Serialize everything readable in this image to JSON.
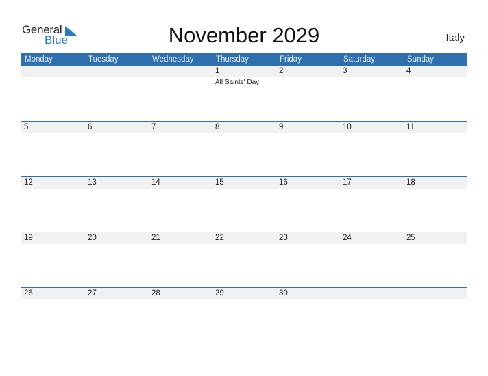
{
  "logo": {
    "line1": "General",
    "line2": "Blue",
    "icon": "triangle-flag-icon"
  },
  "title": "November 2029",
  "country": "Italy",
  "colors": {
    "header_bg": "#2e6fb0",
    "row_bg": "#f1f1f1",
    "logo_blue": "#2a7bc4"
  },
  "weekdays": [
    "Monday",
    "Tuesday",
    "Wednesday",
    "Thursday",
    "Friday",
    "Saturday",
    "Sunday"
  ],
  "weeks": [
    {
      "days": [
        "",
        "",
        "",
        "1",
        "2",
        "3",
        "4"
      ],
      "events": [
        "",
        "",
        "",
        "All Saints' Day",
        "",
        "",
        ""
      ]
    },
    {
      "days": [
        "5",
        "6",
        "7",
        "8",
        "9",
        "10",
        "11"
      ],
      "events": [
        "",
        "",
        "",
        "",
        "",
        "",
        ""
      ]
    },
    {
      "days": [
        "12",
        "13",
        "14",
        "15",
        "16",
        "17",
        "18"
      ],
      "events": [
        "",
        "",
        "",
        "",
        "",
        "",
        ""
      ]
    },
    {
      "days": [
        "19",
        "20",
        "21",
        "22",
        "23",
        "24",
        "25"
      ],
      "events": [
        "",
        "",
        "",
        "",
        "",
        "",
        ""
      ]
    },
    {
      "days": [
        "26",
        "27",
        "28",
        "29",
        "30",
        "",
        ""
      ],
      "events": [
        "",
        "",
        "",
        "",
        "",
        "",
        ""
      ]
    }
  ]
}
